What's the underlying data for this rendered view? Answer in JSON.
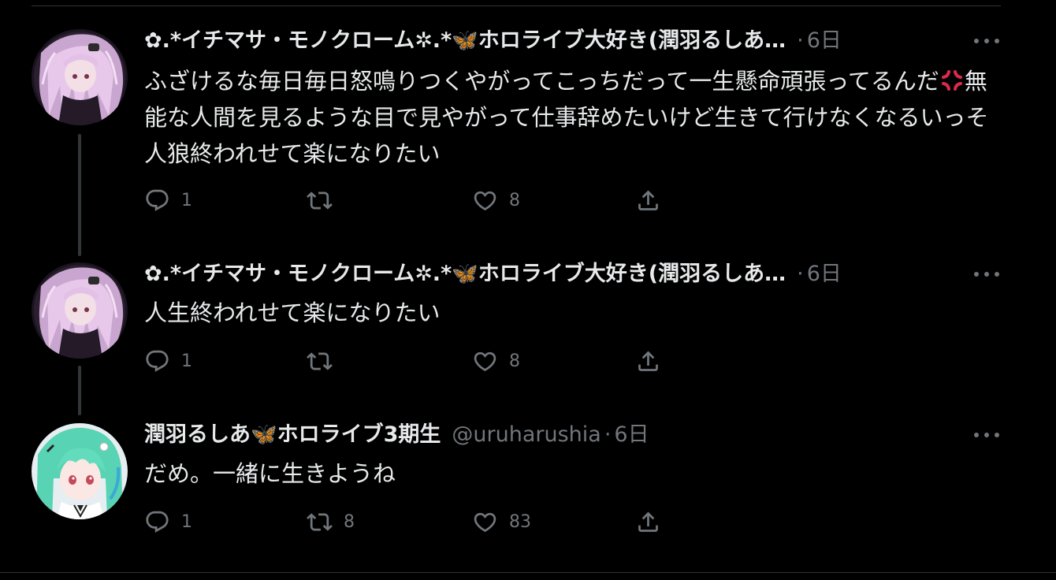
{
  "colors": {
    "background": "#000000",
    "text": "#e7e9ea",
    "secondary": "#71767b",
    "divider": "#2f3336"
  },
  "tweets": [
    {
      "display_name": "✿.*イチマサ・モノクローム✲.*🦋ホロライブ大好き(潤羽るしあ…",
      "dot": "·",
      "time": "6日",
      "avatar_icon": "avatar-pink-hair",
      "text_parts": [
        "ふざけるな毎日毎日怒鳴りつくやがってこっちだって一生懸命頑張ってるんだ",
        "無能な人間を見るような目で見やがって仕事辞めたいけど生きて行けなくなるいっそ人狼終われせて楽になりたい"
      ],
      "inline_emoji": "anger-symbol-icon",
      "actions": {
        "reply": "1",
        "retweet": "",
        "like": "8",
        "share": ""
      }
    },
    {
      "display_name": "✿.*イチマサ・モノクローム✲.*🦋ホロライブ大好き(潤羽るしあ…",
      "dot": "·",
      "time": "6日",
      "avatar_icon": "avatar-pink-hair",
      "text": "人生終われせて楽になりたい",
      "actions": {
        "reply": "1",
        "retweet": "",
        "like": "8",
        "share": ""
      }
    },
    {
      "display_name": "潤羽るしあ🦋ホロライブ3期生",
      "handle": "@uruharushia",
      "dot": "·",
      "time": "6日",
      "avatar_icon": "avatar-green-hair",
      "text": "だめ。一緒に生きようね",
      "actions": {
        "reply": "1",
        "retweet": "8",
        "like": "83",
        "share": ""
      }
    }
  ]
}
